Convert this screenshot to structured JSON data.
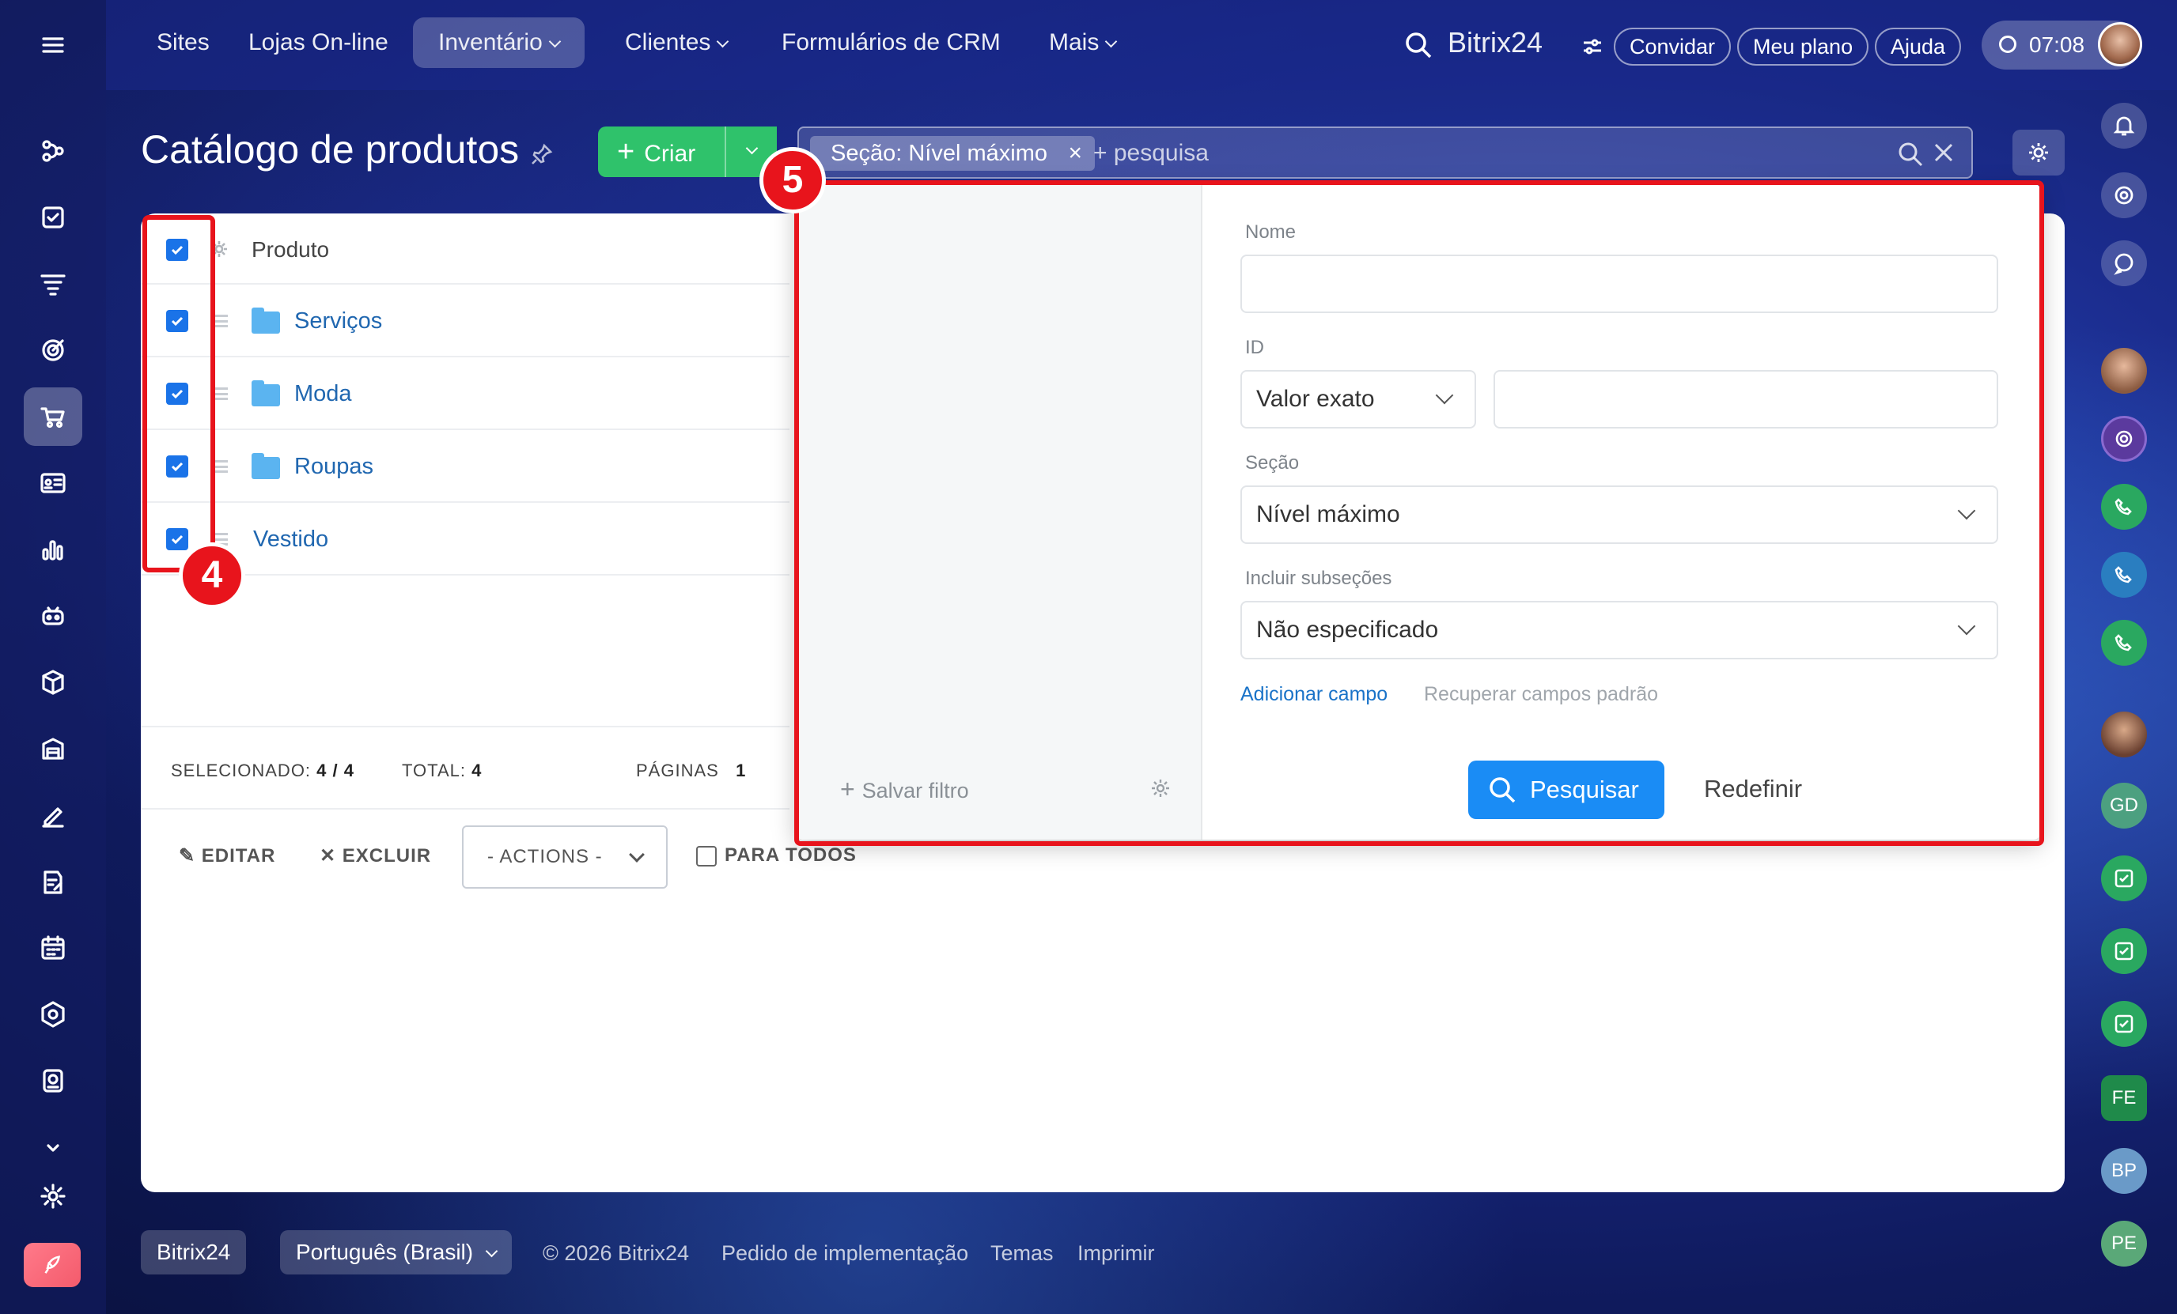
{
  "topnav": {
    "items": [
      {
        "label": "Sites"
      },
      {
        "label": "Lojas On-line"
      },
      {
        "label": "Inventário"
      },
      {
        "label": "Clientes"
      },
      {
        "label": "Formulários de CRM"
      },
      {
        "label": "Mais"
      }
    ],
    "brand": "Bitrix24",
    "invite": "Convidar",
    "plan": "Meu plano",
    "help": "Ajuda",
    "time": "07:08"
  },
  "header": {
    "title": "Catálogo de produtos",
    "create_label": "Criar"
  },
  "search": {
    "tag": "Seção: Nível máximo",
    "placeholder": "+ pesquisa"
  },
  "grid": {
    "column_product": "Produto",
    "rows": [
      {
        "label": "Serviços",
        "type": "folder"
      },
      {
        "label": "Moda",
        "type": "folder"
      },
      {
        "label": "Roupas",
        "type": "folder"
      },
      {
        "label": "Vestido",
        "type": "item"
      }
    ],
    "selected_label": "SELECIONADO:",
    "selected_value": "4 / 4",
    "total_label": "TOTAL:",
    "total_value": "4",
    "pages_label": "PÁGINAS",
    "pages_value": "1"
  },
  "actions": {
    "edit": "EDITAR",
    "delete": "EXCLUIR",
    "select": "- ACTIONS -",
    "for_all": "PARA TODOS"
  },
  "filter": {
    "save_filter": "Salvar filtro",
    "name_label": "Nome",
    "name_value": "",
    "id_label": "ID",
    "id_mode": "Valor exato",
    "id_value": "",
    "section_label": "Seção",
    "section_value": "Nível máximo",
    "subsections_label": "Incluir subseções",
    "subsections_value": "Não especificado",
    "add_field": "Adicionar campo",
    "restore_fields": "Recuperar campos padrão",
    "search_button": "Pesquisar",
    "reset_button": "Redefinir"
  },
  "annotations": {
    "badge_4": "4",
    "badge_5": "5"
  },
  "right_sidebar": {
    "initials": [
      "GD",
      "FE",
      "BP",
      "PE"
    ]
  },
  "footer": {
    "brand": "Bitrix24",
    "language": "Português (Brasil)",
    "copyright": "© 2026 Bitrix24",
    "implementation": "Pedido de implementação",
    "themes": "Temas",
    "print": "Imprimir"
  },
  "colors": {
    "accent": "#1a8cf5",
    "create_green": "#2fc26b",
    "annotation_red": "#e8141c",
    "link_blue": "#2067b0"
  }
}
